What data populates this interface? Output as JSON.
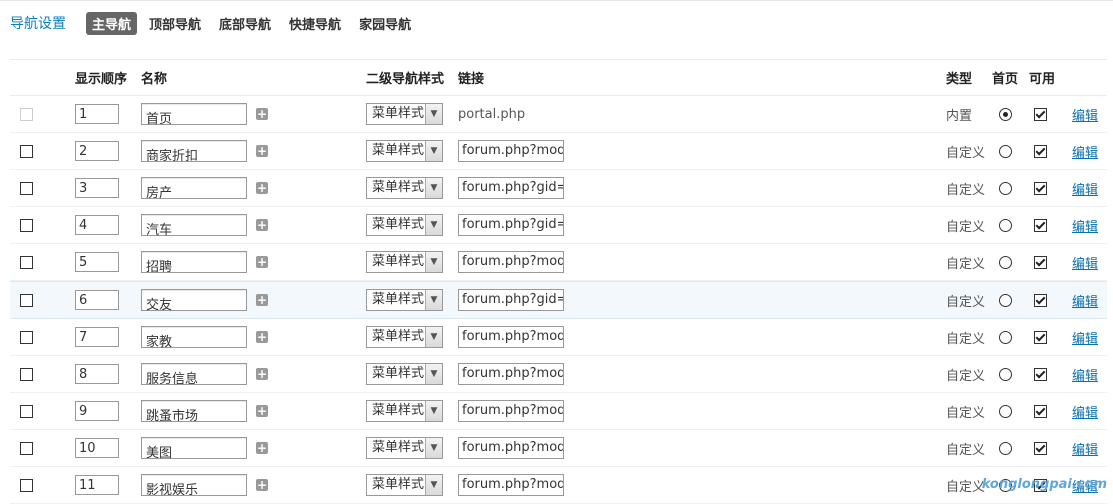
{
  "nav": {
    "title": "导航设置",
    "tabs": [
      "主导航",
      "顶部导航",
      "底部导航",
      "快捷导航",
      "家园导航"
    ],
    "active_tab": 0
  },
  "table": {
    "headers": {
      "order": "显示顺序",
      "name": "名称",
      "style": "二级导航样式",
      "link": "链接",
      "type": "类型",
      "home": "首页",
      "enabled": "可用"
    },
    "rows": [
      {
        "order": "1",
        "name": "首页",
        "style": "菜单样式",
        "link": "portal.php",
        "type": "内置",
        "home": true,
        "enabled": true,
        "edit": "编辑",
        "builtin": true
      },
      {
        "order": "2",
        "name": "商家折扣",
        "style": "菜单样式",
        "link": "forum.php?mod=",
        "type": "自定义",
        "home": false,
        "enabled": true,
        "edit": "编辑",
        "builtin": false
      },
      {
        "order": "3",
        "name": "房产",
        "style": "菜单样式",
        "link": "forum.php?gid=",
        "type": "自定义",
        "home": false,
        "enabled": true,
        "edit": "编辑",
        "builtin": false
      },
      {
        "order": "4",
        "name": "汽车",
        "style": "菜单样式",
        "link": "forum.php?gid=",
        "type": "自定义",
        "home": false,
        "enabled": true,
        "edit": "编辑",
        "builtin": false
      },
      {
        "order": "5",
        "name": "招聘",
        "style": "菜单样式",
        "link": "forum.php?mod=",
        "type": "自定义",
        "home": false,
        "enabled": true,
        "edit": "编辑",
        "builtin": false
      },
      {
        "order": "6",
        "name": "交友",
        "style": "菜单样式",
        "link": "forum.php?gid=",
        "type": "自定义",
        "home": false,
        "enabled": true,
        "edit": "编辑",
        "builtin": false
      },
      {
        "order": "7",
        "name": "家教",
        "style": "菜单样式",
        "link": "forum.php?mod=",
        "type": "自定义",
        "home": false,
        "enabled": true,
        "edit": "编辑",
        "builtin": false
      },
      {
        "order": "8",
        "name": "服务信息",
        "style": "菜单样式",
        "link": "forum.php?mod=",
        "type": "自定义",
        "home": false,
        "enabled": true,
        "edit": "编辑",
        "builtin": false
      },
      {
        "order": "9",
        "name": "跳蚤市场",
        "style": "菜单样式",
        "link": "forum.php?mod=",
        "type": "自定义",
        "home": false,
        "enabled": true,
        "edit": "编辑",
        "builtin": false
      },
      {
        "order": "10",
        "name": "美图",
        "style": "菜单样式",
        "link": "forum.php?mod=",
        "type": "自定义",
        "home": false,
        "enabled": true,
        "edit": "编辑",
        "builtin": false
      },
      {
        "order": "11",
        "name": "影视娱乐",
        "style": "菜单样式",
        "link": "forum.php?mod=",
        "type": "自定义",
        "home": false,
        "enabled": true,
        "edit": "编辑",
        "builtin": false
      }
    ],
    "highlighted_row": 5
  },
  "watermark": "konglongpai.com",
  "icons": {
    "add": "plus-icon",
    "dropdown": "chevron-down-icon"
  }
}
